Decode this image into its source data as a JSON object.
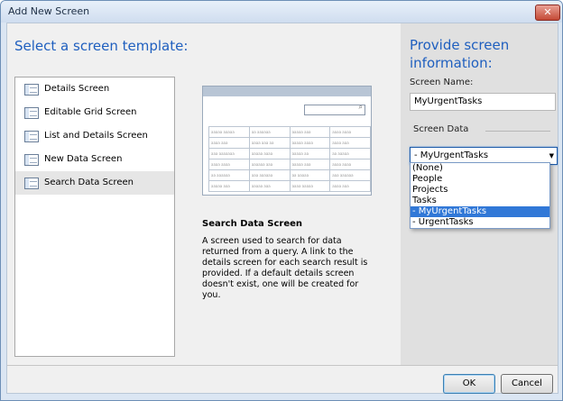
{
  "window": {
    "title": "Add New Screen",
    "close_glyph": "✕"
  },
  "left": {
    "heading": "Select a screen template:",
    "templates": [
      "Details Screen",
      "Editable Grid Screen",
      "List and Details Screen",
      "New Data Screen",
      "Search Data Screen"
    ],
    "selected_template": "Search Data Screen"
  },
  "preview": {
    "search_icon": "search-icon",
    "grid_rows": [
      [
        "aaaaa aaaaa",
        "aa aaaaaa",
        "aaaaa aaa",
        "aaaa aaaa"
      ],
      [
        "aaaa aaa",
        "aaaa aaa aa",
        "aaaaa aaaa",
        "aaaa aaa"
      ],
      [
        "aaa aaaaaaa",
        "aaaaa aaaa",
        "aaaaa aa",
        "aa aaaaa"
      ],
      [
        "aaaa aaaa",
        "aaaaaa aaa",
        "aaaaa aaa",
        "aaaa aaaa"
      ],
      [
        "aa aaaaaa",
        "aaa aaaaaa",
        "aa aaaaa",
        "aaa aaaaaa"
      ],
      [
        "aaaaa aaa",
        "aaaaa aaa",
        "aaaa aaaaa",
        "aaaa aaa"
      ]
    ]
  },
  "description": {
    "title": "Search Data Screen",
    "text": "A screen used to search for data returned from a query.  A link to the details screen for each search result is provided.  If a default details screen doesn't exist, one will be created for you."
  },
  "right": {
    "heading": "Provide screen information:",
    "screen_name_label": "Screen Name:",
    "screen_name_value": "MyUrgentTasks",
    "screen_data_label": "Screen Data",
    "screen_data_value": "- MyUrgentTasks",
    "options": [
      "(None)",
      "People",
      "Projects",
      "Tasks",
      " - MyUrgentTasks",
      " - UrgentTasks"
    ],
    "selected_option": " - MyUrgentTasks"
  },
  "buttons": {
    "ok": "OK",
    "cancel": "Cancel"
  },
  "colors": {
    "heading": "#1f5fbf",
    "selection": "#3178d7"
  }
}
